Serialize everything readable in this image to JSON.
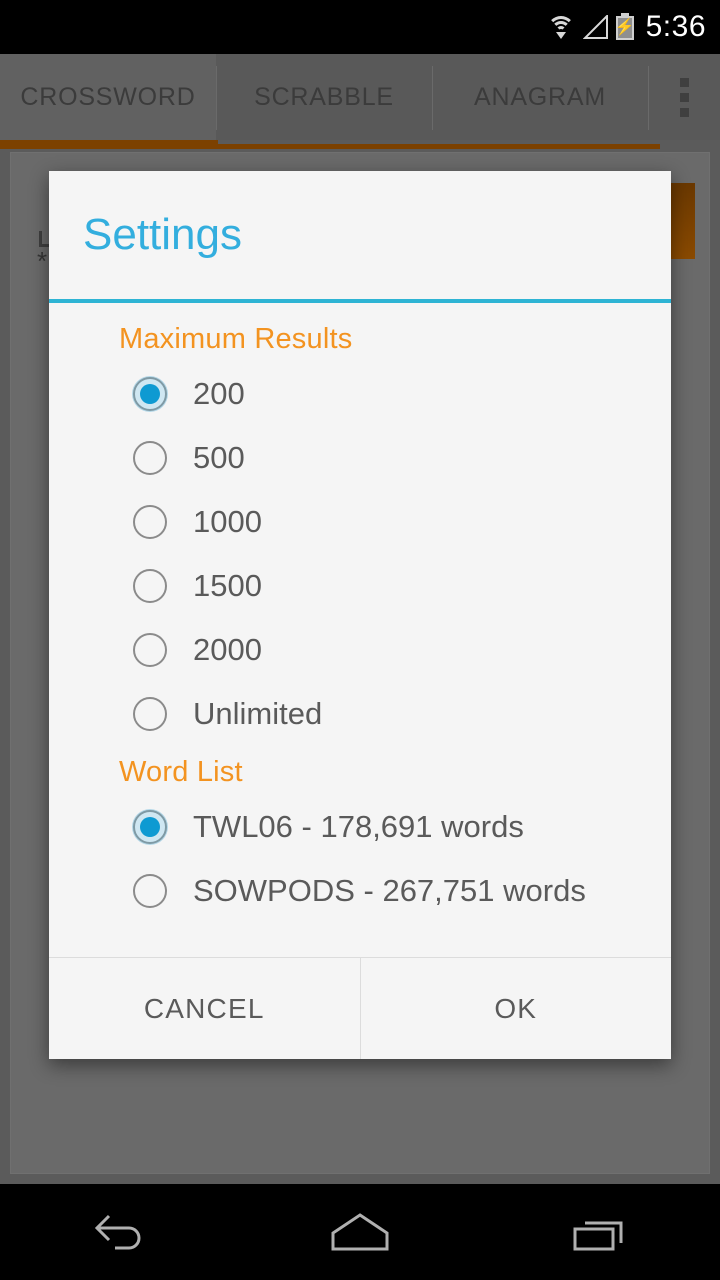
{
  "status_bar": {
    "time": "5:36",
    "icons": [
      "wifi-icon",
      "signal-icon",
      "battery-charging-icon"
    ]
  },
  "tabs": [
    {
      "label": "CROSSWORD",
      "active": true
    },
    {
      "label": "SCRABBLE",
      "active": false
    },
    {
      "label": "ANAGRAM",
      "active": false
    }
  ],
  "overflow_menu": {
    "name": "overflow-menu-icon"
  },
  "dialog": {
    "title": "Settings",
    "sections": [
      {
        "heading": "Maximum Results",
        "options": [
          {
            "label": "200",
            "selected": true
          },
          {
            "label": "500",
            "selected": false
          },
          {
            "label": "1000",
            "selected": false
          },
          {
            "label": "1500",
            "selected": false
          },
          {
            "label": "2000",
            "selected": false
          },
          {
            "label": "Unlimited",
            "selected": false
          }
        ]
      },
      {
        "heading": "Word List",
        "options": [
          {
            "label": "TWL06 - 178,691 words",
            "selected": true
          },
          {
            "label": "SOWPODS - 267,751 words",
            "selected": false
          }
        ]
      }
    ],
    "buttons": {
      "cancel": "CANCEL",
      "ok": "OK"
    }
  },
  "nav_bar": {
    "back": "back-icon",
    "home": "home-icon",
    "recents": "recents-icon"
  },
  "colors": {
    "accent_blue": "#33aede",
    "divider_blue": "#2eb4d4",
    "heading_orange": "#f39320",
    "radio_blue": "#0e9ad2",
    "tab_indicator": "#7c4100",
    "dialog_bg": "#f5f5f5",
    "screen_bg": "#5b5b5b"
  }
}
